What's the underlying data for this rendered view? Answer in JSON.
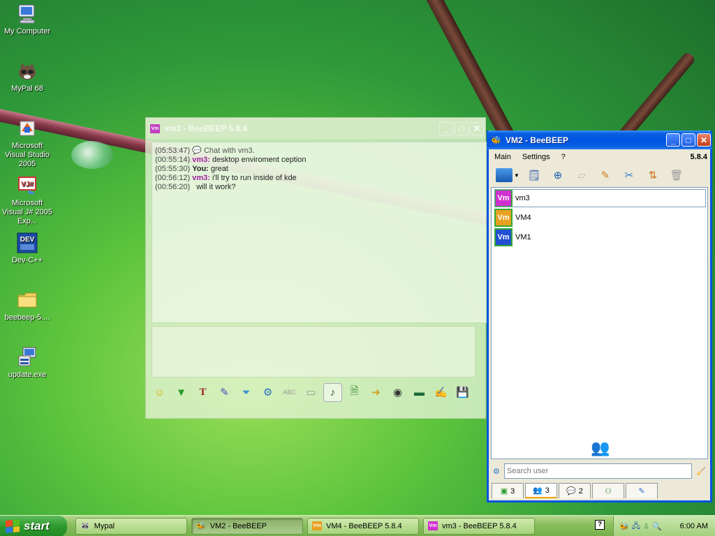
{
  "desktop": {
    "icons": [
      {
        "label": "My Computer",
        "icon": "my-computer-icon"
      },
      {
        "label": "MyPal 68",
        "icon": "mypal-icon"
      },
      {
        "label": "Microsoft Visual Studio 2005",
        "icon": "visual-studio-icon"
      },
      {
        "label": "Microsoft Visual J# 2005 Exp...",
        "icon": "visual-jsharp-icon"
      },
      {
        "label": "Dev-C++",
        "icon": "devcpp-icon"
      },
      {
        "label": "beebeep-5....",
        "icon": "folder-icon"
      },
      {
        "label": "update.exe",
        "icon": "installer-icon"
      }
    ]
  },
  "chat_window": {
    "title": "vm3 - BeeBEEP 5.8.4",
    "badge": "Vm",
    "messages": [
      {
        "time": "(05:53:47)",
        "sender": "",
        "text": "Chat with vm3."
      },
      {
        "time": "(00:55:14)",
        "sender": "vm3:",
        "text": "desktop enviroment ception"
      },
      {
        "time": "(05:55:30)",
        "sender": "You:",
        "text": "great"
      },
      {
        "time": "(00:56:12)",
        "sender": "vm3:",
        "text": "i'll try to run inside of kde"
      },
      {
        "time": "(00:56:20)",
        "sender": "",
        "text": "will it work?"
      }
    ],
    "toolbar_icons": [
      "emoticon-icon",
      "send-file-icon",
      "font-icon",
      "color-icon",
      "filter-icon",
      "settings-icon",
      "spellcheck-icon",
      "completer-icon",
      "sound-icon",
      "save-icon",
      "share-icon",
      "webcam-icon",
      "screenshot-icon",
      "notes-icon",
      "save-chat-icon"
    ]
  },
  "vm2_window": {
    "title": "VM2 - BeeBEEP",
    "menu": [
      "Main",
      "Settings",
      "?"
    ],
    "version": "5.8.4",
    "users": [
      {
        "name": "vm3",
        "badge": "Vm",
        "color": "#d030d0"
      },
      {
        "name": "VM4",
        "badge": "Vm",
        "color": "#e8a020"
      },
      {
        "name": "VM1",
        "badge": "Vm",
        "color": "#2050d0"
      }
    ],
    "search_placeholder": "Search user",
    "tabs": [
      {
        "icon": "chat-list-icon",
        "count": "3"
      },
      {
        "icon": "users-icon",
        "count": "3"
      },
      {
        "icon": "groups-icon",
        "count": "2"
      },
      {
        "icon": "networks-icon",
        "count": ""
      },
      {
        "icon": "log-icon",
        "count": ""
      }
    ]
  },
  "taskbar": {
    "start_label": "start",
    "tasks": [
      {
        "label": "Mypal",
        "active": false
      },
      {
        "label": "VM2 - BeeBEEP",
        "active": true
      },
      {
        "label": "VM4 - BeeBEEP 5.8.4",
        "active": false
      },
      {
        "label": "vm3 - BeeBEEP 5.8.4",
        "active": false
      }
    ],
    "help_label": "?",
    "clock": "6:00 AM"
  }
}
